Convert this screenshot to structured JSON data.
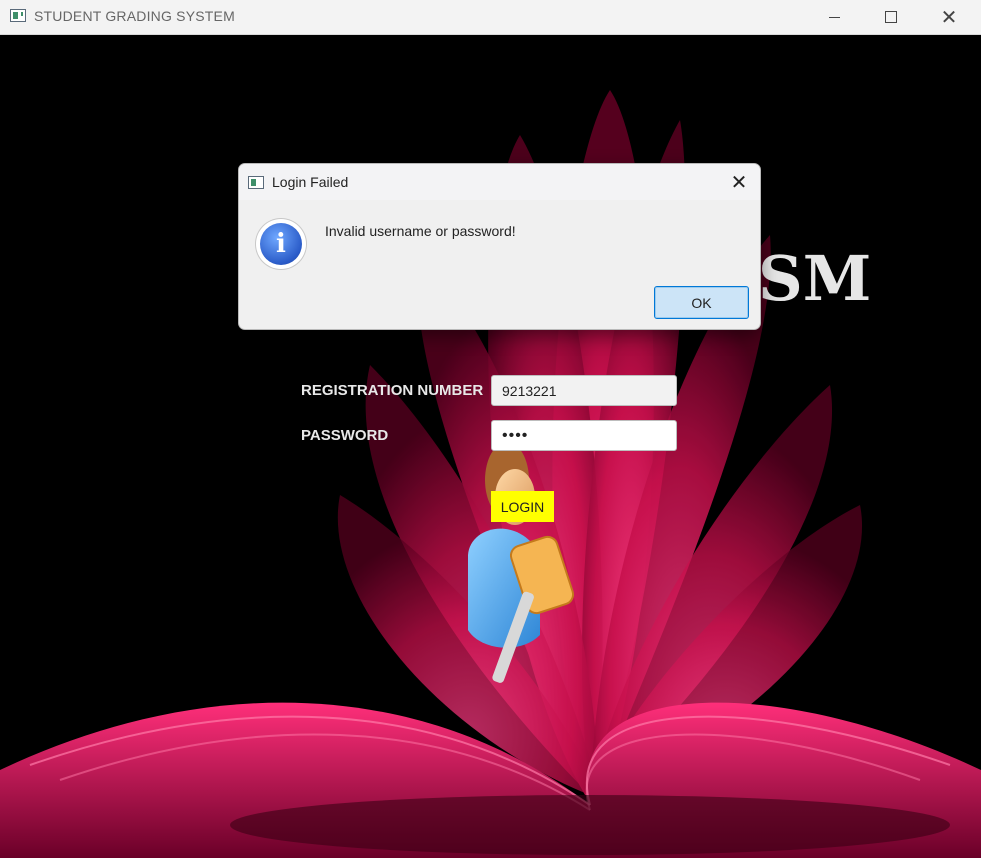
{
  "window": {
    "title": "STUDENT GRADING SYSTEM"
  },
  "background": {
    "visible_title_fragment": "SM",
    "accent_color": "#ff1a6b"
  },
  "form": {
    "reg_label": "REGISTRATION NUMBER",
    "reg_value": "9213221",
    "password_label": "PASSWORD",
    "password_value": "••••",
    "login_label": "LOGIN",
    "login_color": "#ffff00"
  },
  "dialog": {
    "title": "Login Failed",
    "message": "Invalid username or password!",
    "icon": "info-icon",
    "ok_label": "OK"
  }
}
